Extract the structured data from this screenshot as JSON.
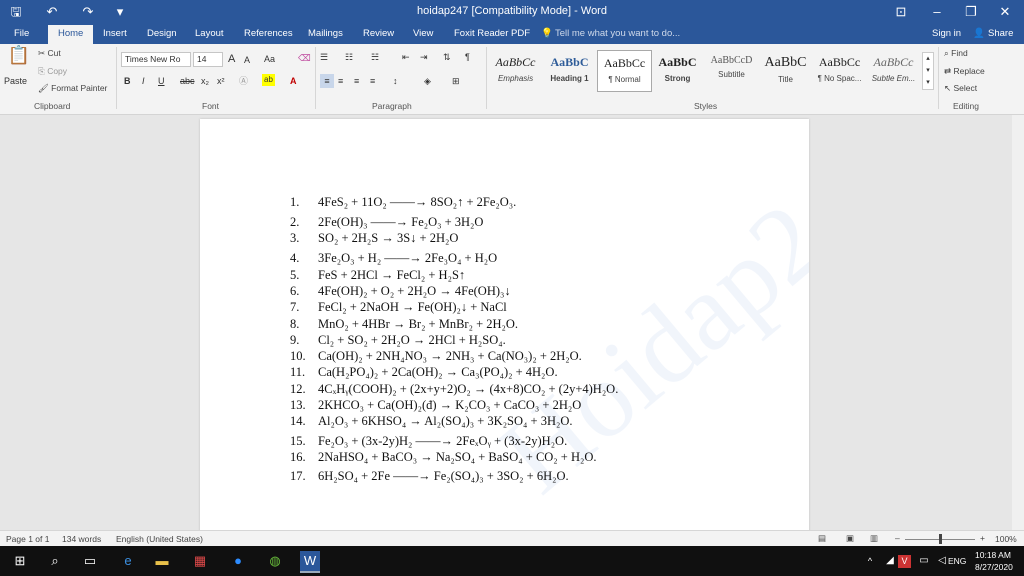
{
  "window": {
    "title": "hoidap247 [Compatibility Mode] - Word",
    "controls": {
      "ribbon_display": "⊡",
      "minimize": "–",
      "restore": "❐",
      "close": "✕"
    }
  },
  "quick_access": {
    "save_icon": "save-icon",
    "undo_icon": "undo-icon",
    "redo_icon": "redo-icon"
  },
  "tabs": [
    "File",
    "Home",
    "Insert",
    "Design",
    "Layout",
    "References",
    "Mailings",
    "Review",
    "View",
    "Foxit Reader PDF"
  ],
  "active_tab": "Home",
  "tell_me": "Tell me what you want to do...",
  "sign_in": "Sign in",
  "share": "Share",
  "clipboard": {
    "paste": "Paste",
    "cut": "Cut",
    "copy": "Copy",
    "format_painter": "Format Painter",
    "label": "Clipboard"
  },
  "font": {
    "name": "Times New Ro",
    "size": "14",
    "label": "Font",
    "grow": "A",
    "shrink": "A",
    "case": "Aa",
    "bold": "B",
    "italic": "I",
    "underline": "U",
    "strike": "abc",
    "subscript": "x₂",
    "superscript": "x²"
  },
  "paragraph": {
    "label": "Paragraph",
    "pilcrow": "¶"
  },
  "styles": {
    "label": "Styles",
    "items": [
      {
        "sample": "AaBbCc",
        "name": "Emphasis"
      },
      {
        "sample": "AaBbC",
        "name": "Heading 1"
      },
      {
        "sample": "AaBbCc",
        "name": "¶ Normal"
      },
      {
        "sample": "AaBbC",
        "name": "Strong"
      },
      {
        "sample": "AaBbCcD",
        "name": "Subtitle"
      },
      {
        "sample": "AaBbC",
        "name": "Title"
      },
      {
        "sample": "AaBbCc",
        "name": "¶ No Spac..."
      },
      {
        "sample": "AaBbCc",
        "name": "Subtle Em..."
      }
    ]
  },
  "editing": {
    "find": "Find",
    "replace": "Replace",
    "select": "Select",
    "label": "Editing"
  },
  "document": {
    "equations": [
      {
        "n": "1.",
        "text": "4FeS₂ + 11O₂ ——→ 8SO₂↑ + 2Fe₂O₃."
      },
      {
        "n": "2.",
        "text": "2Fe(OH)₃ ——→ Fe₂O₃ + 3H₂O"
      },
      {
        "n": "3.",
        "text": "SO₂ + 2H₂S → 3S↓ + 2H₂O"
      },
      {
        "n": "4.",
        "text": "3Fe₂O₃ + H₂ ——→ 2Fe₃O₄ + H₂O"
      },
      {
        "n": "5.",
        "text": "FeS + 2HCl → FeCl₂ + H₂S↑"
      },
      {
        "n": "6.",
        "text": "4Fe(OH)₂ + O₂ + 2H₂O → 4Fe(OH)₃↓"
      },
      {
        "n": "7.",
        "text": "FeCl₂ + 2NaOH → Fe(OH)₂↓ + NaCl"
      },
      {
        "n": "8.",
        "text": "MnO₂ + 4HBr → Br₂ + MnBr₂ + 2H₂O."
      },
      {
        "n": "9.",
        "text": "Cl₂ + SO₂ + 2H₂O → 2HCl + H₂SO₄."
      },
      {
        "n": "10.",
        "text": "Ca(OH)₂ + 2NH₄NO₃ → 2NH₃ + Ca(NO₃)₂ + 2H₂O."
      },
      {
        "n": "11.",
        "text": "Ca(H₂PO₄)₂ + 2Ca(OH)₂ → Ca₃(PO₄)₂ + 4H₂O."
      },
      {
        "n": "12.",
        "text": "4CₓHᵧ(COOH)₂ + (2x+y+2)O₂ → (4x+8)CO₂ + (2y+4)H₂O."
      },
      {
        "n": "13.",
        "text": "2KHCO₃ + Ca(OH)₂(đ) → K₂CO₃ + CaCO₃ + 2H₂O"
      },
      {
        "n": "14.",
        "text": "Al₂O₃ + 6KHSO₄ → Al₂(SO₄)₃ + 3K₂SO₄ + 3H₂O."
      },
      {
        "n": "15.",
        "text": "Fe₂O₃ + (3x-2y)H₂ ——→ 2FeₓOᵧ + (3x-2y)H₂O."
      },
      {
        "n": "16.",
        "text": "2NaHSO₄ + BaCO₃ → Na₂SO₄ + BaSO₄ + CO₂ + H₂O."
      },
      {
        "n": "17.",
        "text": "6H₂SO₄ + 2Fe ——→ Fe₂(SO₄)₃ + 3SO₂ + 6H₂O."
      }
    ],
    "watermark": "Hoidap247"
  },
  "status": {
    "page": "Page 1 of 1",
    "words": "134 words",
    "language": "English (United States)",
    "zoom": "100%",
    "zoom_minus": "–",
    "zoom_plus": "+"
  },
  "taskbar": {
    "lang": "ENG",
    "time": "10:18 AM",
    "date": "8/27/2020"
  }
}
